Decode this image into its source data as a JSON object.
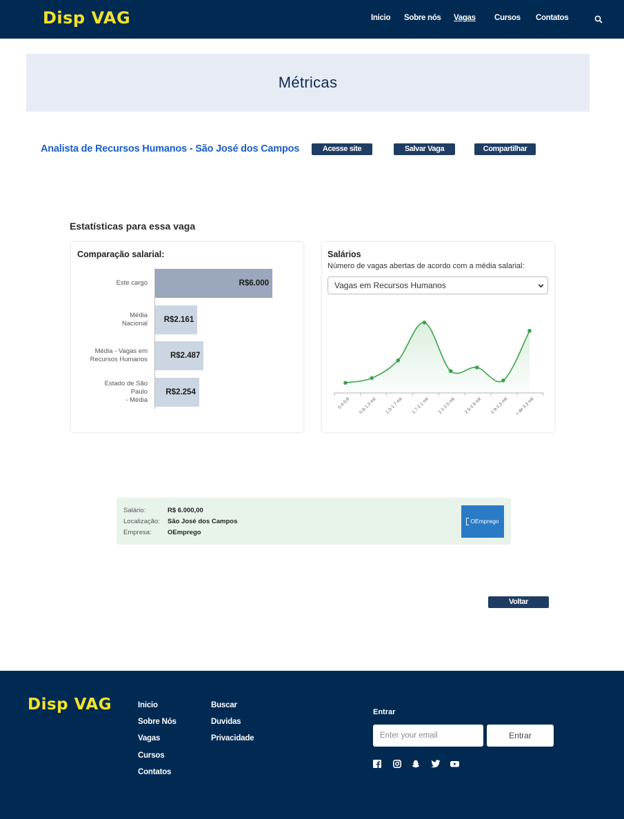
{
  "header": {
    "logo": "Disp VAG",
    "nav": [
      "Inicio",
      "Sobre nós",
      "Vagas",
      "Cursos",
      "Contatos"
    ],
    "active_nav": "Vagas"
  },
  "banner": {
    "title": "Métricas"
  },
  "job": {
    "title": "Analista de Recursos Humanos - São José dos Campos",
    "buttons": {
      "visit": "Acesse site",
      "save": "Salvar Vaga",
      "share": "Compartilhar"
    }
  },
  "stats": {
    "title": "Estatísticas para essa vaga",
    "comparison_heading": "Comparação salarial:",
    "salaries_heading": "Salários",
    "salaries_subtitle": "Número de vagas abertas de acordo com a média salarial:",
    "select_value": "Vagas em Recursos Humanos"
  },
  "chart_data": [
    {
      "type": "bar",
      "orientation": "horizontal",
      "title": "Comparação salarial:",
      "categories": [
        "Este cargo",
        "Média Nacional",
        "Média - Vagas em Recursos Humanos",
        "Estado de São Paulo - Média"
      ],
      "category_lines": [
        [
          "Este cargo"
        ],
        [
          "Média",
          "Nacional"
        ],
        [
          "Média - Vagas em",
          "Recursos Humanos"
        ],
        [
          "Estado de São",
          "Paulo",
          "- Média"
        ]
      ],
      "values": [
        6000,
        2161,
        2487,
        2254
      ],
      "value_labels": [
        "R$6.000",
        "R$2.161",
        "R$2.487",
        "R$2.254"
      ],
      "xlim": [
        0,
        6000
      ],
      "colors": [
        "#9aa7bd",
        "#ccd5e2",
        "#ccd5e2",
        "#ccd5e2"
      ]
    },
    {
      "type": "area",
      "title": "Salários",
      "subtitle": "Número de vagas abertas de acordo com a média salarial:",
      "categories": [
        "0.4-0.8",
        "0.8-1.3 mil",
        "1.3-1.7 mil",
        "1.7-2.1 mil",
        "2.1-2.5 mil",
        "2.5-2.9 mil",
        "2.9-3.3 mil",
        "+ de 3.3 mil"
      ],
      "values": [
        8,
        12,
        27,
        59,
        18,
        21,
        10,
        52
      ],
      "ylim": [
        0,
        70
      ],
      "color": "#3aa34a",
      "grid": false
    }
  ],
  "details": {
    "salary_label": "Salário:",
    "salary_value": "R$ 6.000,00",
    "location_label": "Localização:",
    "location_value": "São José dos Campos",
    "company_label": "Empresa:",
    "company_value": "OEmprego",
    "company_logo": "OEmprego"
  },
  "back_button": "Voltar",
  "footer": {
    "logo": "Disp VAG",
    "col1": [
      "Inicio",
      "Sobre Nós",
      "Vagas",
      "Cursos",
      "Contatos"
    ],
    "col2": [
      "Buscar",
      "Duvidas",
      "Privacidade"
    ],
    "login_label": "Entrar",
    "email_placeholder": "Enter your email",
    "login_button": "Entrar",
    "social_icons": [
      "facebook-icon",
      "instagram-icon",
      "snapchat-icon",
      "twitter-icon",
      "youtube-icon"
    ]
  }
}
